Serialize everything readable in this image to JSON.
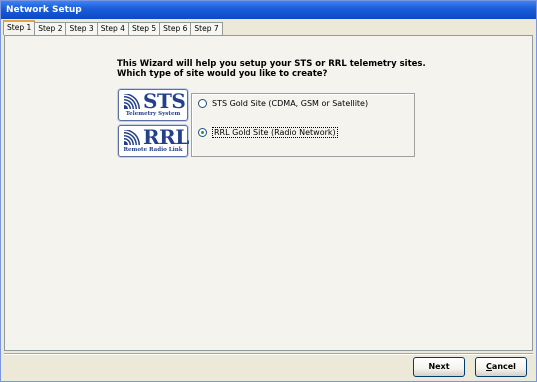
{
  "window": {
    "title": "Network Setup"
  },
  "tabs": [
    {
      "label": "Step 1",
      "active": true
    },
    {
      "label": "Step 2"
    },
    {
      "label": "Step 3"
    },
    {
      "label": "Step 4"
    },
    {
      "label": "Step 5"
    },
    {
      "label": "Step 6"
    },
    {
      "label": "Step 7"
    }
  ],
  "intro": {
    "line1": "This Wizard will help you setup your STS or RRL telemetry sites.",
    "line2": "Which type of site would you like to create?"
  },
  "logos": {
    "sts": {
      "big": "STS",
      "sub": "Telemetry System",
      "icon": "radio-waves-icon"
    },
    "rrl": {
      "big": "RRL",
      "sub": "Remote Radio Link",
      "icon": "radio-waves-icon"
    }
  },
  "options": [
    {
      "label": "STS Gold Site (CDMA, GSM or Satellite)",
      "selected": false
    },
    {
      "label": "RRL Gold Site (Radio Network)",
      "selected": true
    }
  ],
  "buttons": {
    "next": "Next",
    "cancel_first": "C",
    "cancel_rest": "ancel"
  },
  "colors": {
    "titlebar": "#0c48c7",
    "logo_blue": "#24408a",
    "tab_accent": "#e8a33d"
  }
}
